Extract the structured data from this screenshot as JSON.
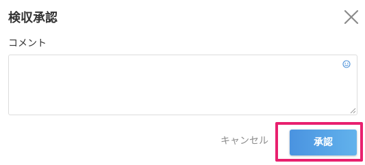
{
  "dialog": {
    "title": "検収承認",
    "close_icon": "close-icon"
  },
  "comment": {
    "label": "コメント",
    "value": "",
    "emoji_icon": "smiley-icon",
    "resize_icon": "resize-grip-icon"
  },
  "actions": {
    "cancel_label": "キャンセル",
    "approve_label": "承認",
    "highlight_color": "#e8206e",
    "approve_color": "#4a93e0"
  }
}
